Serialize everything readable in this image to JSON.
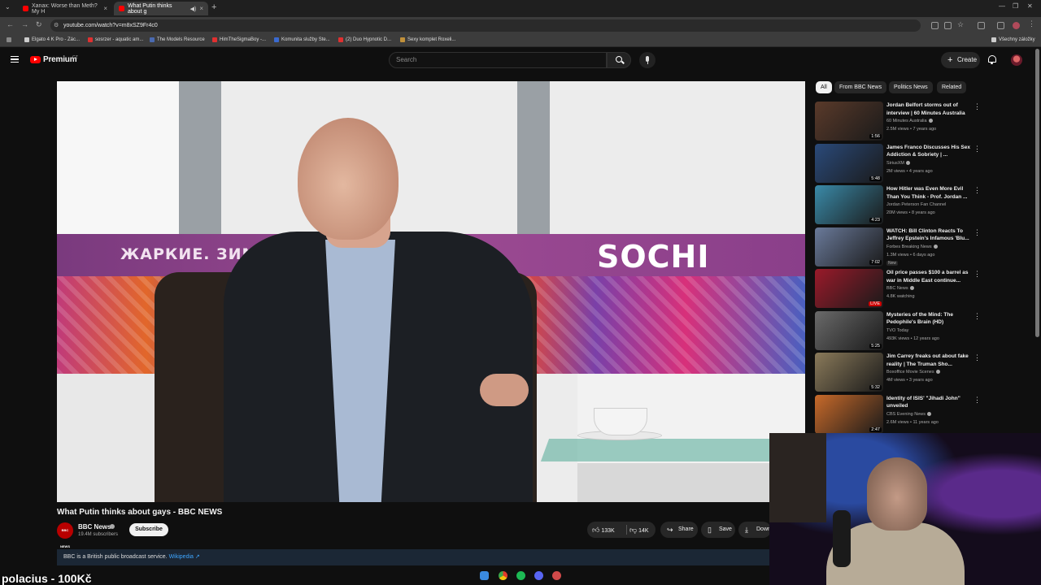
{
  "browser": {
    "tabs": [
      {
        "title": "Xanax: Worse than Meth? My H",
        "active": false
      },
      {
        "title": "What Putin thinks about g",
        "active": true
      }
    ],
    "url": "youtube.com/watch?v=m8xSZ9Fr4c0",
    "bookmarks": [
      "Elgato 4 K Pro - Zác...",
      "sosrzer - aquatic am...",
      "The Models Resource",
      "HimTheSigmaBoy -...",
      "Komunita služby Ste...",
      "(2) Duo Hypnotic D...",
      "Sexy komplet Roxeli..."
    ],
    "all_bookmarks": "Všechny záložky"
  },
  "masthead": {
    "logo": "Premium",
    "country": "CZ",
    "search_placeholder": "Search",
    "create_label": "Create"
  },
  "video": {
    "title": "What Putin thinks about gays - BBC NEWS",
    "banner_left": "ЖАРКИЕ. ЗИМН",
    "banner_right": "SOCHI 2014",
    "channel": "BBC News",
    "channel_logo": "BBC NEWS",
    "subscribers": "19.4M subscribers",
    "subscribe_label": "Subscribe",
    "likes": "133K",
    "dislikes": "14K",
    "share_label": "Share",
    "save_label": "Save",
    "download_label": "Down",
    "info_text": "BBC is a British public broadcast service.",
    "info_link": "Wikipedia ↗"
  },
  "chips": [
    "All",
    "From BBC News",
    "Politics News",
    "Related"
  ],
  "recommendations": [
    {
      "title": "Jordan Belfort storms out of interview | 60 Minutes Australia",
      "channel": "60 Minutes Australia",
      "verified": true,
      "meta": "2.5M views • 7 years ago",
      "duration": "1:56",
      "color": "#5a3a2a",
      "badge": ""
    },
    {
      "title": "James Franco Discusses His Sex Addiction & Sobriety | ...",
      "channel": "SiriusXM",
      "verified": true,
      "meta": "2M views • 4 years ago",
      "duration": "5:48",
      "color": "#2a4a7a",
      "badge": ""
    },
    {
      "title": "How Hitler was Even More Evil Than You Think - Prof. Jordan ...",
      "channel": "Jordan Peterson Fan Channel",
      "verified": false,
      "meta": "20M views • 8 years ago",
      "duration": "4:23",
      "color": "#3a8aa8",
      "badge": ""
    },
    {
      "title": "WATCH: Bill Clinton Reacts To Jeffrey Epstein's Infamous 'Blu...",
      "channel": "Forbes Breaking News",
      "verified": true,
      "meta": "1.3M views • 6 days ago",
      "duration": "7:02",
      "color": "#6a7a9a",
      "badge": "New"
    },
    {
      "title": "Oil price passes $100 a barrel as war in Middle East continue...",
      "channel": "BBC News",
      "verified": true,
      "meta": "4.8K watching",
      "duration": "LIVE",
      "color": "#9a1a2a",
      "badge": ""
    },
    {
      "title": "Mysteries of the Mind: The Pedophile's Brain (HD)",
      "channel": "TVO Today",
      "verified": false,
      "meta": "493K views • 12 years ago",
      "duration": "5:25",
      "color": "#6a6a6a",
      "badge": ""
    },
    {
      "title": "Jim Carrey freaks out about fake reality | The Truman Sho...",
      "channel": "Boxoffice Movie Scenes",
      "verified": true,
      "meta": "4M views • 3 years ago",
      "duration": "5:32",
      "color": "#8a7a5a",
      "badge": ""
    },
    {
      "title": "Identity of ISIS' \"Jihadi John\" unveiled",
      "channel": "CBS Evening News",
      "verified": true,
      "meta": "2.6M views • 11 years ago",
      "duration": "2:47",
      "color": "#c86a2a",
      "badge": ""
    }
  ],
  "overlay": {
    "promo_text": "polacius - 100Kč"
  }
}
